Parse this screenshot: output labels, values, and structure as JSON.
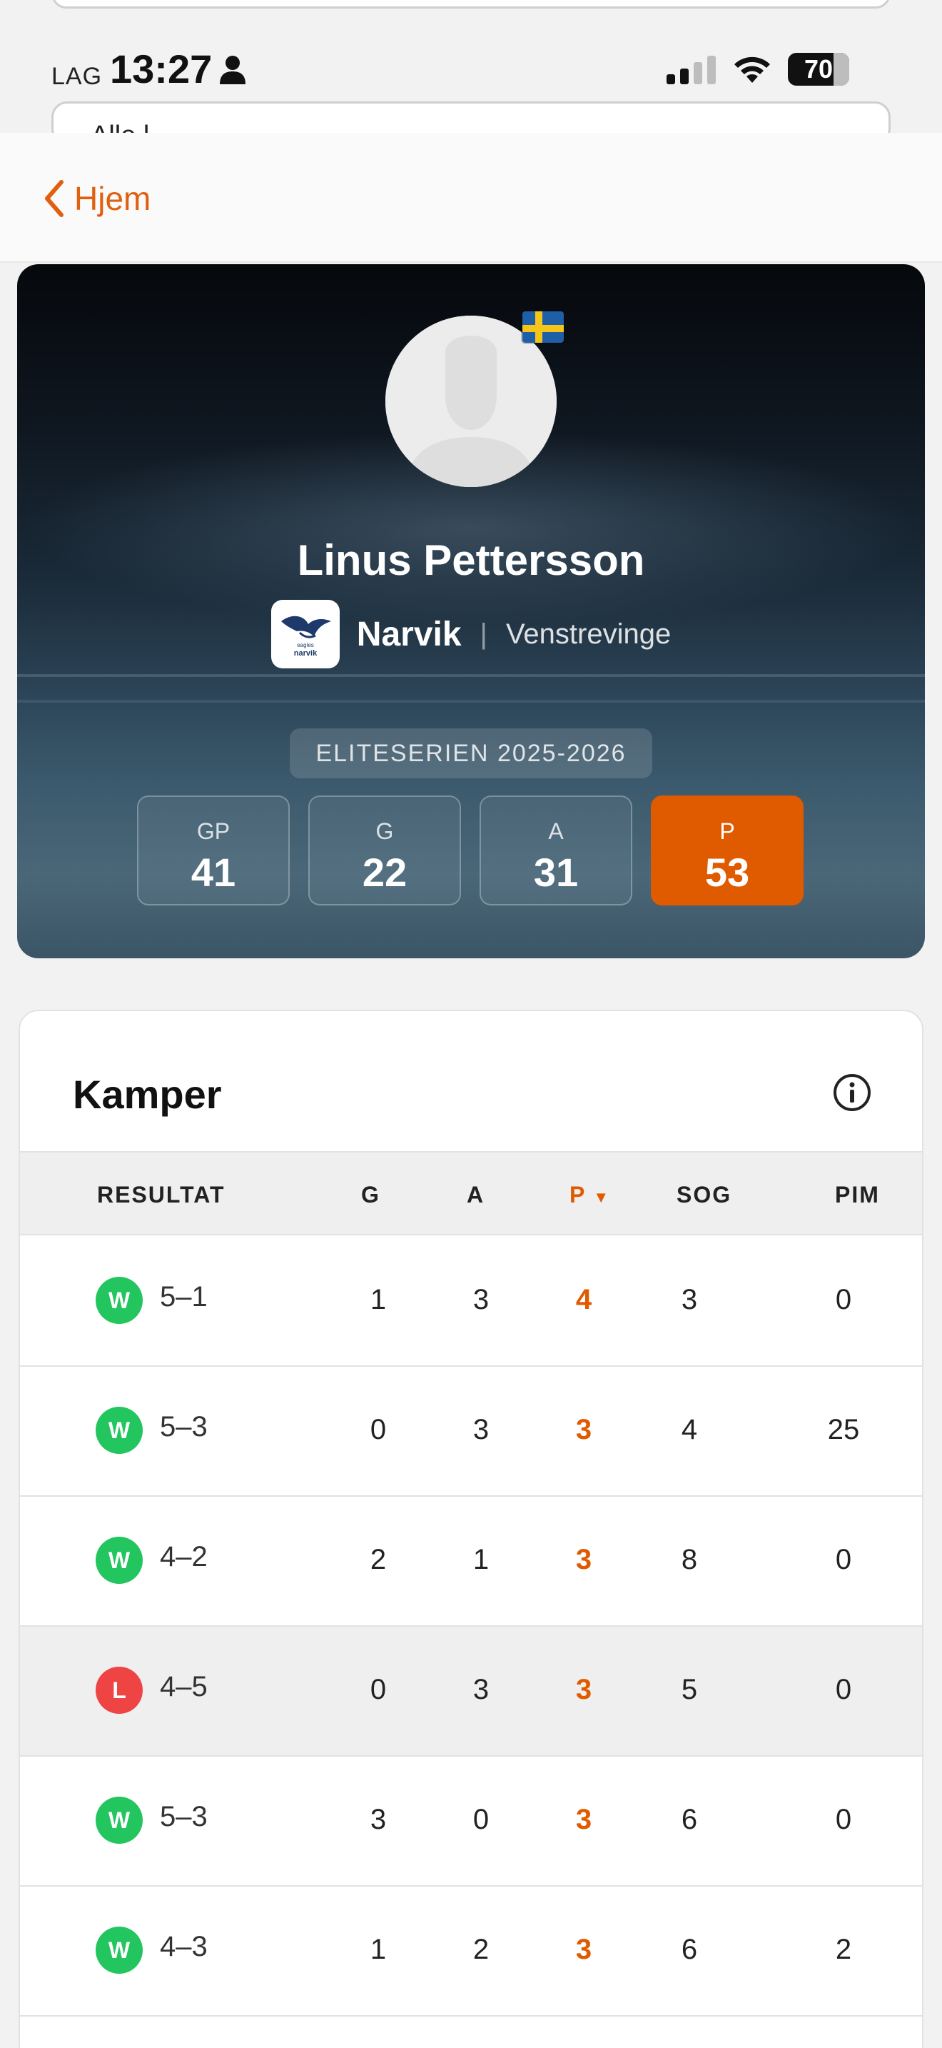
{
  "status_bar": {
    "carrier": "LAG",
    "time": "13:27",
    "battery": "70"
  },
  "ghost_search": {
    "text": "Alle l"
  },
  "nav": {
    "back_label": "Hjem"
  },
  "player": {
    "name": "Linus Pettersson",
    "team": "Narvik",
    "position": "Venstrevinge",
    "flag": "sweden-flag-icon",
    "team_logo_text_top": "arctic eagles",
    "team_logo_text_bottom": "narvik hockey"
  },
  "season": {
    "label": "ELITESERIEN 2025-2026",
    "stats": [
      {
        "label": "GP",
        "value": "41",
        "highlight": false
      },
      {
        "label": "G",
        "value": "22",
        "highlight": false
      },
      {
        "label": "A",
        "value": "31",
        "highlight": false
      },
      {
        "label": "P",
        "value": "53",
        "highlight": true
      }
    ]
  },
  "games": {
    "title": "Kamper",
    "columns": [
      "RESULTAT",
      "G",
      "A",
      "P",
      "SOG",
      "PIM"
    ],
    "sorted_column": "P",
    "rows": [
      {
        "result": "W",
        "score": "5–1",
        "g": "1",
        "a": "3",
        "p": "4",
        "sog": "3",
        "pim": "0"
      },
      {
        "result": "W",
        "score": "5–3",
        "g": "0",
        "a": "3",
        "p": "3",
        "sog": "4",
        "pim": "25"
      },
      {
        "result": "W",
        "score": "4–2",
        "g": "2",
        "a": "1",
        "p": "3",
        "sog": "8",
        "pim": "0"
      },
      {
        "result": "L",
        "score": "4–5",
        "g": "0",
        "a": "3",
        "p": "3",
        "sog": "5",
        "pim": "0"
      },
      {
        "result": "W",
        "score": "5–3",
        "g": "3",
        "a": "0",
        "p": "3",
        "sog": "6",
        "pim": "0"
      },
      {
        "result": "W",
        "score": "4–3",
        "g": "1",
        "a": "2",
        "p": "3",
        "sog": "6",
        "pim": "2"
      }
    ]
  },
  "colors": {
    "accent": "#e05a00",
    "win": "#22c55e",
    "loss": "#ef4444"
  }
}
